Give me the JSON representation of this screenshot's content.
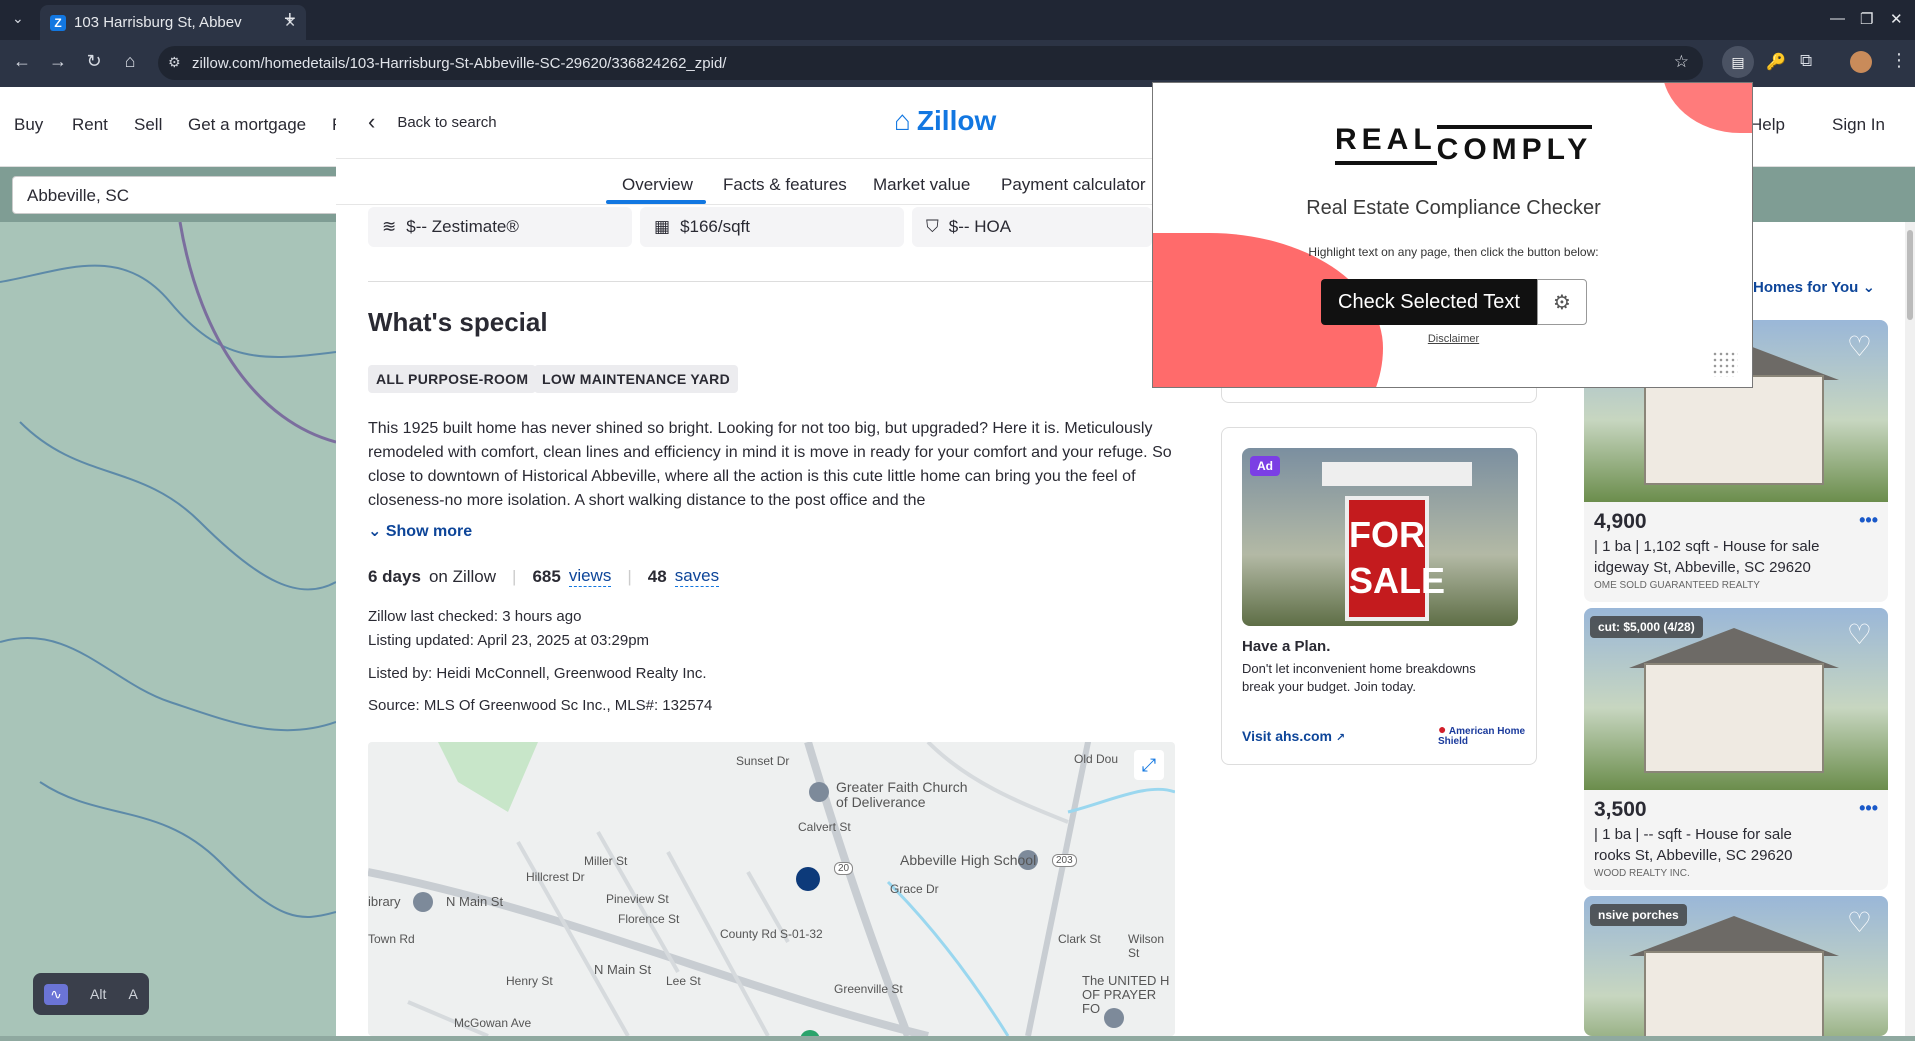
{
  "browser": {
    "tab_title": "103 Harrisburg St, Abbev",
    "url": "zillow.com/homedetails/103-Harrisburg-St-Abbeville-SC-29620/336824262_zpid/"
  },
  "site_nav": {
    "items": [
      "Buy",
      "Rent",
      "Sell",
      "Get a mortgage",
      "F"
    ],
    "help": "Help",
    "sign_in": "Sign In"
  },
  "search": {
    "value": "Abbeville, SC"
  },
  "detail": {
    "back": "Back to search",
    "logo": "Zillow",
    "tabs": [
      "Overview",
      "Facts & features",
      "Market value",
      "Payment calculator"
    ],
    "stats": [
      "$-- Zestimate®",
      "$166/sqft",
      "$-- HOA"
    ],
    "whats_special": "What's special",
    "chips": [
      "ALL PURPOSE-ROOM",
      "LOW MAINTENANCE YARD"
    ],
    "description": "This 1925 built home has never shined so bright. Looking for not too big, but upgraded? Here it is. Meticulously remodeled with comfort, clean lines and efficiency in mind it is move in ready for your comfort and your refuge. So close to downtown of Historical Abbeville, where all the action is this cute little home can bring you the feel of closeness-no more isolation. A short walking distance to the post office and the",
    "show_more": "Show more",
    "days": "6 days",
    "on_zillow": "on Zillow",
    "views_count": "685",
    "views_label": "views",
    "saves_count": "48",
    "saves_label": "saves",
    "last_checked": "Zillow last checked: 3 hours ago",
    "listing_updated": "Listing updated: April 23, 2025 at 03:29pm",
    "listed_by": "Listed by: Heidi McConnell, Greenwood Realty Inc.",
    "source": "Source: MLS Of Greenwood Sc Inc.,   MLS#: 132574",
    "map_labels": [
      "Sunset Dr",
      "Greater Faith Church of Deliverance",
      "Old Dou",
      "Miller St",
      "Calvert St",
      "Abbeville High School",
      "Grace Dr",
      "ibrary",
      "N Main St",
      "Hillcrest Dr",
      "Pineview St",
      "Florence St",
      "County Rd S-01-32",
      "N Main St",
      "Lee St",
      "Henry St",
      "Greenville St",
      "Clark St",
      "Wilson St",
      "The UNITED H OF PRAYER FO",
      "McGowan Ave",
      "Town Rd",
      "20",
      "203"
    ]
  },
  "ad": {
    "badge": "Ad",
    "sign_text": "FOR SALE",
    "title": "Have a Plan.",
    "text": "Don't let inconvenient home breakdowns break your budget. Join today.",
    "link": "Visit ahs.com",
    "brand": "American Home Shield"
  },
  "popup": {
    "logo_left": "REAL",
    "logo_right": "COMPLY",
    "title": "Real Estate Compliance Checker",
    "instruction": "Highlight text on any page, then click the button below:",
    "button": "Check Selected Text",
    "disclaimer": "Disclaimer"
  },
  "homes_for_you": "Homes for You",
  "listings": [
    {
      "price": "4,900",
      "specs": "| 1 ba | 1,102 sqft - House for sale",
      "address": "idgeway St, Abbeville, SC 29620",
      "broker": "OME SOLD GUARANTEED REALTY",
      "badge": ""
    },
    {
      "price": "3,500",
      "specs": "| 1 ba | -- sqft - House for sale",
      "address": "rooks St, Abbeville, SC 29620",
      "broker": "WOOD REALTY INC.",
      "badge": "cut: $5,000 (4/28)"
    },
    {
      "price": "",
      "specs": "",
      "address": "",
      "broker": "",
      "badge": "nsive porches"
    }
  ],
  "map_controls": [
    "Alt",
    "A"
  ]
}
